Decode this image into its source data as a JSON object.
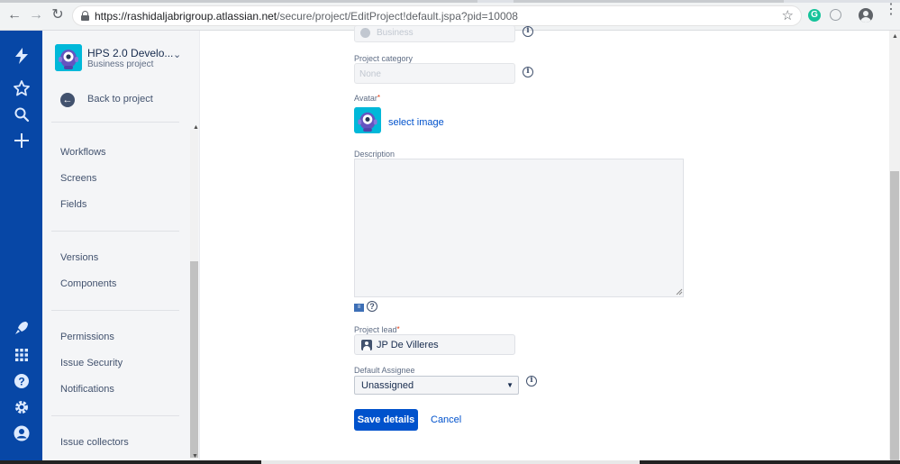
{
  "browser": {
    "url_host": "https://rashidaljabrigroup.atlassian.net",
    "url_path": "/secure/project/EditProject!default.jspa?pid=10008"
  },
  "project": {
    "name": "HPS 2.0 Develo...",
    "type": "Business project"
  },
  "sidebar": {
    "back_label": "Back to project",
    "items": [
      {
        "label": "Workflows"
      },
      {
        "label": "Screens"
      },
      {
        "label": "Fields"
      },
      {
        "label": "Versions"
      },
      {
        "label": "Components"
      },
      {
        "label": "Permissions"
      },
      {
        "label": "Issue Security"
      },
      {
        "label": "Notifications"
      },
      {
        "label": "Issue collectors"
      }
    ]
  },
  "form": {
    "project_type_value": "Business",
    "project_category_label": "Project category",
    "project_category_placeholder": "None",
    "avatar_label": "Avatar",
    "required_mark": "*",
    "select_image": "select image",
    "description_label": "Description",
    "description_value": "",
    "project_lead_label": "Project lead",
    "project_lead_value": "JP De Villeres",
    "default_assignee_label": "Default Assignee",
    "default_assignee_value": "Unassigned",
    "save_label": "Save details",
    "cancel_label": "Cancel"
  },
  "colors": {
    "global_nav": "#0747a6",
    "primary": "#0052cc",
    "avatar_bg": "#00b8d9"
  }
}
